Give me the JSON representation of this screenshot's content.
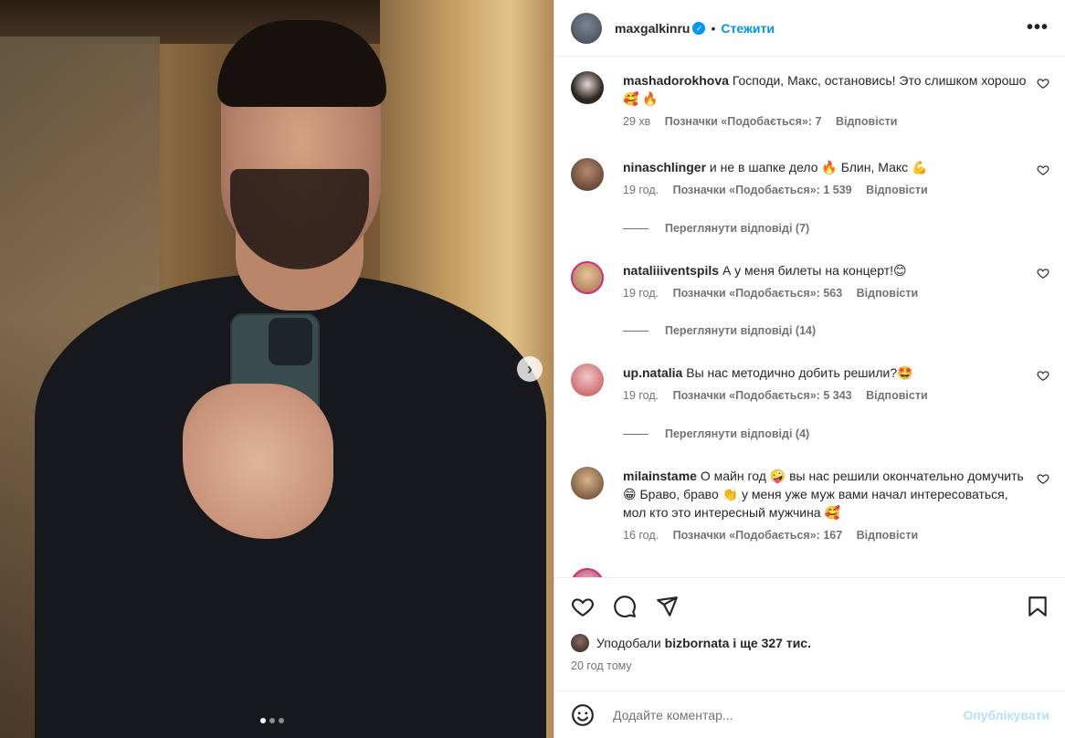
{
  "post": {
    "username": "maxgalkinru",
    "separator": "•",
    "follow_label": "Стежити",
    "more_label": "•••",
    "next_label": "›"
  },
  "comments": [
    {
      "user": "mashadorokhova",
      "text": "Господи, Макс, остановись! Это слишком хорошо 🥰 🔥",
      "time": "29 хв",
      "likes": "Позначки «Подобається»: 7",
      "reply": "Відповісти"
    },
    {
      "user": "ninaschlinger",
      "text": "и не в шапке дело 🔥 Блин, Макс 💪",
      "time": "19 год.",
      "likes": "Позначки «Подобається»: 1 539",
      "reply": "Відповісти",
      "view_replies": "Переглянути відповіді (7)"
    },
    {
      "user": "nataliiiventspils",
      "text": "А у меня билеты на концерт!😊",
      "time": "19 год.",
      "likes": "Позначки «Подобається»: 563",
      "reply": "Відповісти",
      "view_replies": "Переглянути відповіді (14)"
    },
    {
      "user": "up.natalia",
      "text": "Вы нас методично добить решили?🤩",
      "time": "19 год.",
      "likes": "Позначки «Подобається»: 5 343",
      "reply": "Відповісти",
      "view_replies": "Переглянути відповіді (4)"
    },
    {
      "user": "milainstame",
      "text": "О майн год 🤪 вы нас решили окончательно домучить 😁 Браво, браво 👏 у меня уже муж вами начал интересоваться, мол кто это интересный мужчина 🥰",
      "time": "16 год.",
      "likes": "Позначки «Подобається»: 167",
      "reply": "Відповісти"
    }
  ],
  "likes_summary": {
    "prefix": "Уподобали",
    "user": "bizbornata",
    "suffix": "і ще 327 тис."
  },
  "posted_time": "20 год тому",
  "comment_box": {
    "placeholder": "Додайте коментар...",
    "post_label": "Опублікувати"
  },
  "carousel": {
    "count": 3,
    "active": 0
  },
  "colors": {
    "accent": "#0095f6",
    "muted": "#737373",
    "post_disabled": "#b2dffc"
  }
}
